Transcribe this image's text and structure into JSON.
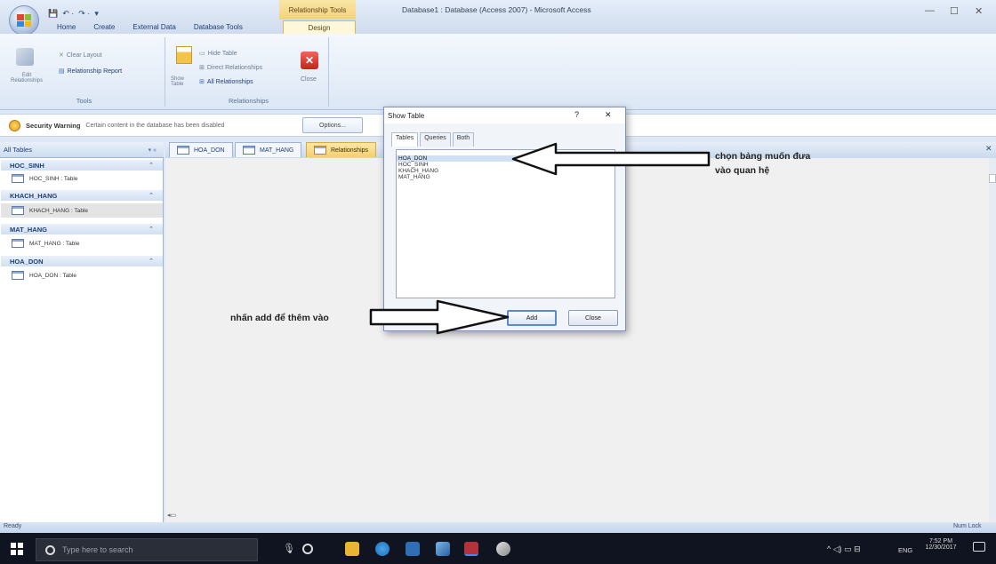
{
  "window": {
    "title": "Database1 : Database (Access 2007) - Microsoft Access",
    "context_tools": "Relationship Tools",
    "controls": {
      "minimize": "—",
      "maximize": "☐",
      "close": "✕"
    }
  },
  "qat": {
    "save": "💾",
    "undo": "↶ ·",
    "redo": "↷ ·",
    "more": "▾"
  },
  "tabs": [
    "Home",
    "Create",
    "External Data",
    "Database Tools"
  ],
  "design_tab": "Design",
  "ribbon": {
    "tools_group": {
      "label": "Tools",
      "edit_relationships": "Edit Relationships",
      "clear_layout": "Clear Layout",
      "relationship_report": "Relationship Report"
    },
    "relationships_group": {
      "label": "Relationships",
      "show_table": "Show Table",
      "hide_table": "Hide Table",
      "direct_relationships": "Direct Relationships",
      "all_relationships": "All Relationships",
      "close": "Close"
    }
  },
  "security_bar": {
    "title": "Security Warning",
    "message": "Certain content in the database has been disabled",
    "options_button": "Options..."
  },
  "nav": {
    "header": "All Tables",
    "groups": [
      {
        "name": "HOC_SINH",
        "item": "HOC_SINH : Table"
      },
      {
        "name": "KHACH_HANG",
        "item": "KHACH_HANG : Table"
      },
      {
        "name": "MAT_HANG",
        "item": "MAT_HANG : Table"
      },
      {
        "name": "HOA_DON",
        "item": "HOA_DON : Table"
      }
    ]
  },
  "doc_tabs": [
    "HOA_DON",
    "MAT_HANG",
    "Relationships"
  ],
  "status": {
    "left": "Ready",
    "right": "Num Lock"
  },
  "dialog": {
    "title": "Show Table",
    "help": "?",
    "close": "✕",
    "tabs": [
      "Tables",
      "Queries",
      "Both"
    ],
    "tables": [
      "HOA_DON",
      "HOC_SINH",
      "KHACH_HANG",
      "MAT_HANG"
    ],
    "add_button": "Add",
    "close_button": "Close"
  },
  "annotations": {
    "choose": "chọn bảng muốn đưa",
    "choose_line2": "vào quan hệ",
    "add": "nhấn add để thêm vào"
  },
  "taskbar": {
    "search_placeholder": "Type here to search",
    "lang": "ENG",
    "time": "7:52 PM",
    "date": "12/30/2017"
  },
  "colors": {
    "accent": "#f3d27b",
    "ribbon": "#dce7f5",
    "taskbar": "#101420"
  }
}
